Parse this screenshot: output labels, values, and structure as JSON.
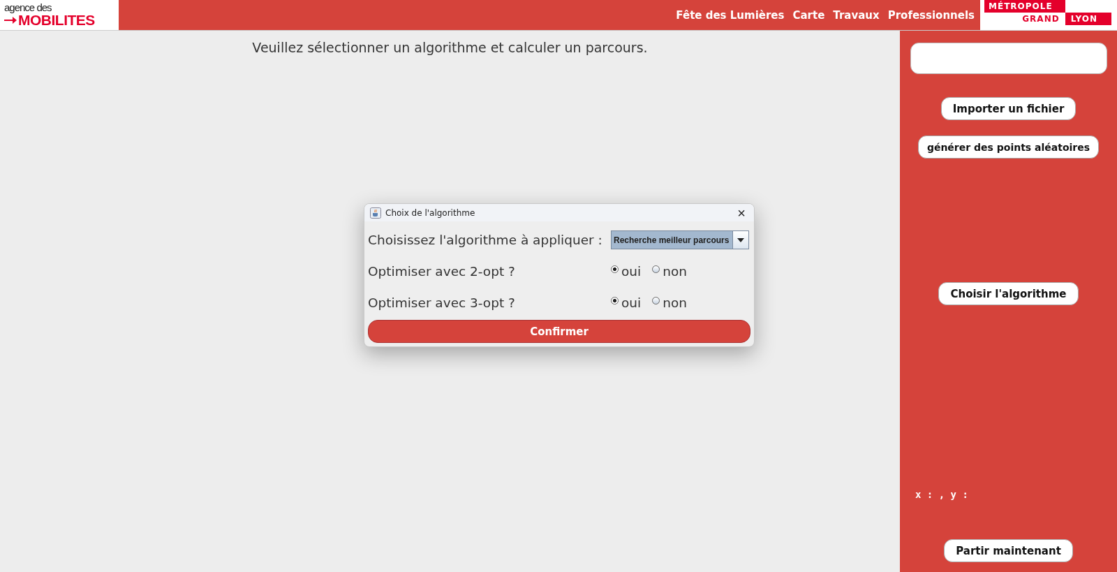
{
  "header": {
    "logo_top": "agence des",
    "logo_bottom": "MOBILITES",
    "nav": [
      "Fête des Lumières",
      "Carte",
      "Travaux",
      "Professionnels"
    ],
    "partner_logo": {
      "line1": "MÉTROPOLE",
      "line2a": "GRAND",
      "line2b": "LYON"
    }
  },
  "main": {
    "message": "Veuillez sélectionner un algorithme et calculer un parcours."
  },
  "sidebar": {
    "buttons_top": [
      "Importer un fichier",
      "générer des points aléatoires"
    ],
    "button_middle": "Choisir l'algorithme",
    "coords": "x : , y :",
    "button_bottom": "Partir maintenant"
  },
  "dialog": {
    "title": "Choix de l'algorithme",
    "close": "×",
    "algo_label": "Choisissez l'algorithme à appliquer :",
    "algo_value": "Recherche meilleur parcours",
    "options": [
      {
        "label": "Optimiser avec 2-opt ?",
        "choices": [
          {
            "label": "oui",
            "selected": true
          },
          {
            "label": "non",
            "selected": false
          }
        ]
      },
      {
        "label": "Optimiser avec 3-opt ?",
        "choices": [
          {
            "label": "oui",
            "selected": true
          },
          {
            "label": "non",
            "selected": false
          }
        ]
      }
    ],
    "confirm": "Confirmer"
  }
}
